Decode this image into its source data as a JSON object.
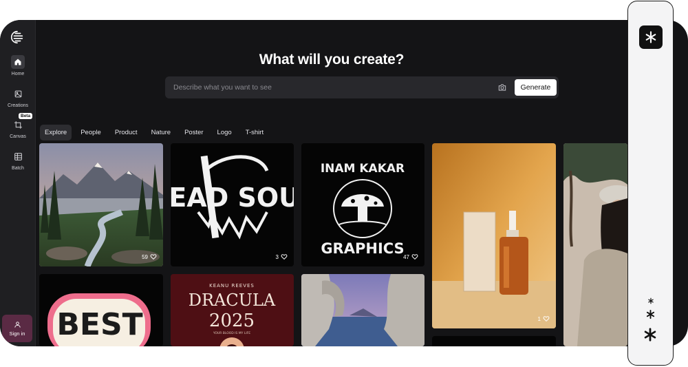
{
  "sidebar": {
    "items": [
      {
        "label": "Home"
      },
      {
        "label": "Creations"
      },
      {
        "label": "Canvas",
        "badge": "Beta"
      },
      {
        "label": "Batch"
      }
    ],
    "signin_label": "Sign in"
  },
  "main": {
    "headline": "What will you create?",
    "search_placeholder": "Describe what you want to see",
    "generate_label": "Generate",
    "tabs": [
      "Explore",
      "People",
      "Product",
      "Nature",
      "Poster",
      "Logo",
      "T-shirt"
    ]
  },
  "gallery": [
    {
      "title": "Mountain river landscape",
      "likes": "59"
    },
    {
      "title": "DEAD SOUL",
      "likes": "3"
    },
    {
      "title_top": "INAM KAKAR",
      "title_bottom": "GRAPHICS",
      "likes": "47"
    },
    {
      "title": "Serum bottle product",
      "likes": "1"
    },
    {
      "title": "Woman in cap"
    },
    {
      "title": "BEST"
    },
    {
      "kicker": "KEANU REEVES",
      "title": "DRACULA",
      "year": "2025",
      "tagline": "YOUR BLOOD IS MY LIFE"
    },
    {
      "title": "Sea arch"
    }
  ],
  "colors": {
    "background": "#141416",
    "sidebar": "#1f1f22",
    "accent_signin": "#5a2a44"
  }
}
